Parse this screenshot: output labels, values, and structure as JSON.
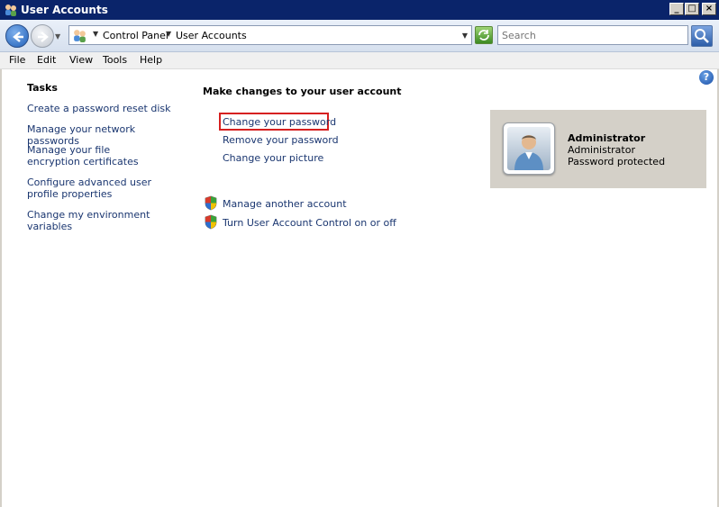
{
  "window": {
    "title": "User Accounts",
    "controls": {
      "minimize": "_",
      "maximize": "□",
      "close": "×"
    }
  },
  "navbar": {
    "breadcrumb": [
      "Control Panel",
      "User Accounts"
    ],
    "search_placeholder": "Search"
  },
  "menu": [
    "File",
    "Edit",
    "View",
    "Tools",
    "Help"
  ],
  "sidebar": {
    "title": "Tasks",
    "items": [
      "Create a password reset disk",
      "Manage your network passwords",
      "Manage your file encryption certificates",
      "Configure advanced user profile properties",
      "Change my environment variables"
    ]
  },
  "main": {
    "title": "Make changes to your user account",
    "links": [
      "Change your password",
      "Remove your password",
      "Change your picture"
    ],
    "shield_links": [
      "Manage another account",
      "Turn User Account Control on or off"
    ]
  },
  "account": {
    "name": "Administrator",
    "type": "Administrator",
    "status": "Password protected"
  },
  "icons": {
    "back": "back-arrow-icon",
    "forward": "forward-arrow-icon",
    "refresh": "refresh-icon",
    "search": "search-icon",
    "help": "help-icon",
    "shield": "uac-shield-icon"
  },
  "colors": {
    "titlebar": "#0a246a",
    "link": "#1a3670",
    "highlight_box": "#d62020",
    "account_panel": "#d4d0c8"
  }
}
